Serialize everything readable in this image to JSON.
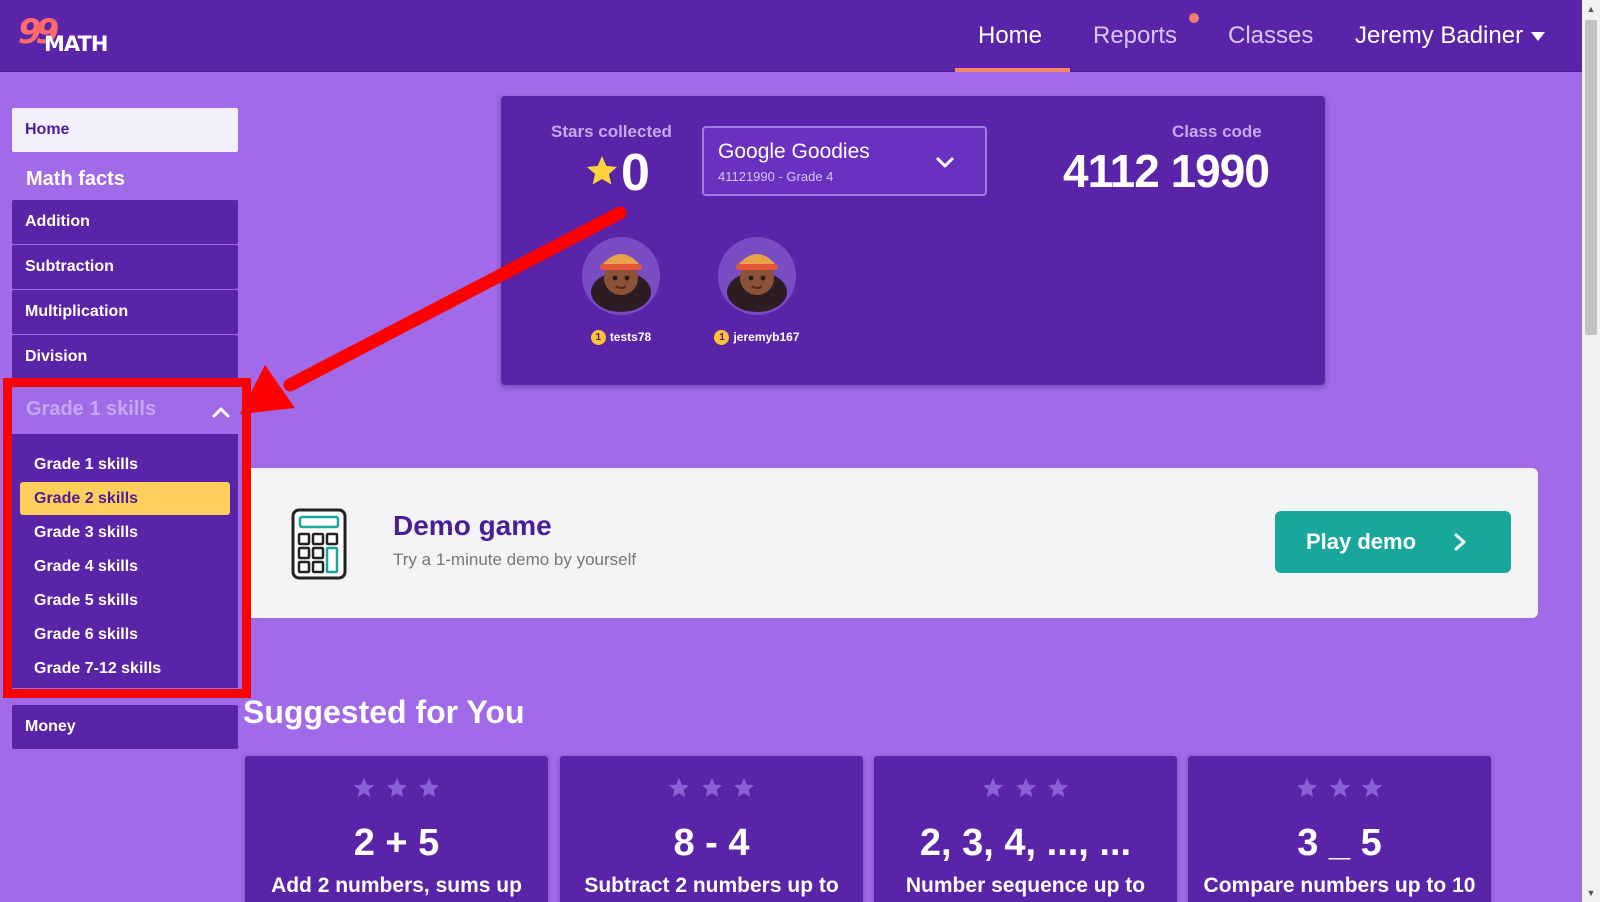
{
  "header": {
    "logo_number": "99",
    "logo_text": "MATH",
    "nav": {
      "home": "Home",
      "reports": "Reports",
      "classes": "Classes",
      "user": "Jeremy Badiner"
    }
  },
  "sidebar": {
    "home": "Home",
    "section_title": "Math facts",
    "items": [
      "Addition",
      "Subtraction",
      "Multiplication",
      "Division"
    ],
    "grade_header": "Grade 1 skills",
    "grades": [
      "Grade 1 skills",
      "Grade 2 skills",
      "Grade 3 skills",
      "Grade 4 skills",
      "Grade 5 skills",
      "Grade 6 skills",
      "Grade 7-12 skills"
    ],
    "selected_grade": "Grade 2 skills",
    "money": "Money"
  },
  "stats": {
    "stars_label": "Stars collected",
    "stars_value": "0",
    "class_name": "Google Goodies",
    "class_sub": "41121990 - Grade 4",
    "code_label": "Class code",
    "code_value": "4112 1990",
    "students": [
      {
        "badge": "1",
        "name": "tests78"
      },
      {
        "badge": "1",
        "name": "jeremyb167"
      }
    ]
  },
  "demo": {
    "title": "Demo game",
    "subtitle": "Try a 1-minute demo by yourself",
    "button": "Play demo"
  },
  "suggested": {
    "title": "Suggested for You",
    "cards": [
      {
        "expr": "2 + 5",
        "desc": "Add 2 numbers, sums up"
      },
      {
        "expr": "8 - 4",
        "desc": "Subtract 2 numbers up to"
      },
      {
        "expr": "2, 3, 4, ..., ...",
        "desc": "Number sequence up to"
      },
      {
        "expr": "3 _ 5",
        "desc": "Compare numbers up to 10"
      }
    ]
  },
  "colors": {
    "background": "#a06ae8",
    "panel": "#5a24a8",
    "highlight": "#ffcf5c",
    "accent_teal": "#17a89b",
    "annotation_red": "#ff0000"
  },
  "icons": [
    "star-icon",
    "chevron-down-icon",
    "chevron-up-icon",
    "calculator-icon",
    "chevron-right-icon",
    "avatar"
  ]
}
